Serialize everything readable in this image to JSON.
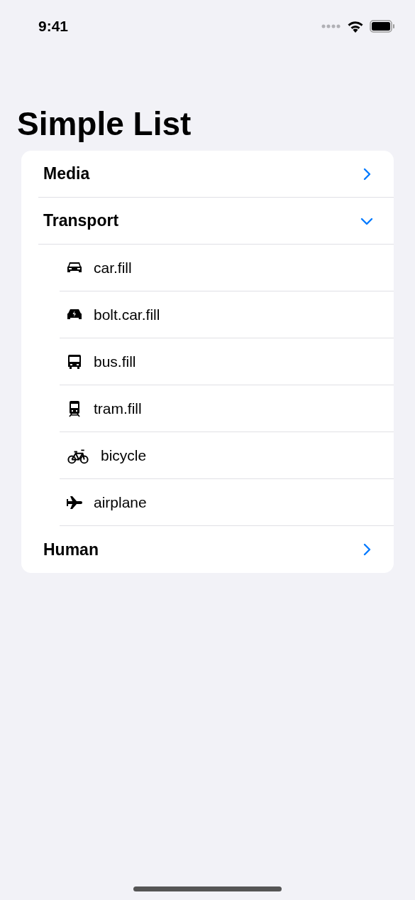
{
  "status_bar": {
    "time": "9:41"
  },
  "title": "Simple List",
  "sections": [
    {
      "label": "Media",
      "expanded": false
    },
    {
      "label": "Transport",
      "expanded": true,
      "children": [
        {
          "kind": "car",
          "label": "car.fill"
        },
        {
          "kind": "bolt-car",
          "label": "bolt.car.fill"
        },
        {
          "kind": "bus",
          "label": "bus.fill"
        },
        {
          "kind": "tram",
          "label": "tram.fill"
        },
        {
          "kind": "bicycle",
          "label": "bicycle"
        },
        {
          "kind": "airplane",
          "label": "airplane"
        }
      ]
    },
    {
      "label": "Human",
      "expanded": false
    }
  ]
}
